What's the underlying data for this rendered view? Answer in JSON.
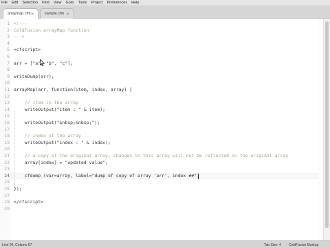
{
  "menu": [
    "File",
    "Edit",
    "Selection",
    "Find",
    "View",
    "Goto",
    "Tools",
    "Project",
    "Preferences",
    "Help"
  ],
  "tabs": [
    {
      "label": "arraymap.cfm",
      "close": "×",
      "active": true
    },
    {
      "label": "sample.cfm",
      "close": "×",
      "active": false
    }
  ],
  "editor": {
    "current_line": 24,
    "lines": [
      {
        "num": "1",
        "parts": [
          {
            "t": "<!---",
            "cls": "c"
          }
        ]
      },
      {
        "num": "2",
        "parts": [
          {
            "t": "ColdFusion arrayMap function",
            "cls": "c"
          }
        ]
      },
      {
        "num": "3",
        "parts": [
          {
            "t": "--->",
            "cls": "c"
          }
        ]
      },
      {
        "num": "4",
        "parts": []
      },
      {
        "num": "5",
        "parts": [
          {
            "t": "<cfscript>",
            "cls": ""
          }
        ]
      },
      {
        "num": "6",
        "parts": []
      },
      {
        "num": "7",
        "parts": [
          {
            "t": "arr = [\"a\", \"b\", \"c\"];",
            "cls": ""
          }
        ]
      },
      {
        "num": "8",
        "parts": []
      },
      {
        "num": "9",
        "parts": [
          {
            "t": "writeDump(arr);",
            "cls": ""
          }
        ]
      },
      {
        "num": "10",
        "parts": []
      },
      {
        "num": "11",
        "parts": [
          {
            "t": "arrayMap(arr, function(item, index, array) {",
            "cls": ""
          }
        ]
      },
      {
        "num": "12",
        "parts": []
      },
      {
        "num": "13",
        "parts": [
          {
            "t": "    // item in the array",
            "cls": "c"
          }
        ]
      },
      {
        "num": "14",
        "parts": [
          {
            "t": "    writeOutput(\"item : \" & item);",
            "cls": ""
          }
        ]
      },
      {
        "num": "15",
        "parts": []
      },
      {
        "num": "16",
        "parts": [
          {
            "t": "    writeOutput(\"&nbsp;&nbsp;\");",
            "cls": ""
          }
        ]
      },
      {
        "num": "17",
        "parts": []
      },
      {
        "num": "18",
        "parts": [
          {
            "t": "    // index of the array",
            "cls": "c"
          }
        ]
      },
      {
        "num": "19",
        "parts": [
          {
            "t": "    writeOutput(\"index : \" & index);",
            "cls": ""
          }
        ]
      },
      {
        "num": "20",
        "parts": []
      },
      {
        "num": "21",
        "parts": [
          {
            "t": "    // a copy of the original array, changes to this array will not be reflected in the original array",
            "cls": "c"
          }
        ]
      },
      {
        "num": "22",
        "parts": [
          {
            "t": "    array[index] = \"updated value\";",
            "cls": ""
          }
        ]
      },
      {
        "num": "23",
        "parts": []
      },
      {
        "num": "24",
        "parts": [
          {
            "t": "    cfdump (var=array, label=\"dump of copy of array 'arr', index ##\")",
            "cls": ""
          }
        ]
      },
      {
        "num": "25",
        "parts": []
      },
      {
        "num": "26",
        "parts": [
          {
            "t": "});",
            "cls": ""
          }
        ]
      },
      {
        "num": "27",
        "parts": []
      },
      {
        "num": "28",
        "parts": [
          {
            "t": "</cfscript>",
            "cls": ""
          }
        ]
      },
      {
        "num": "29",
        "parts": []
      }
    ]
  },
  "status": {
    "position": "Line 24, Column 67",
    "tab_size": "Tab Size: 4",
    "syntax": "ColdFusion Markup"
  }
}
